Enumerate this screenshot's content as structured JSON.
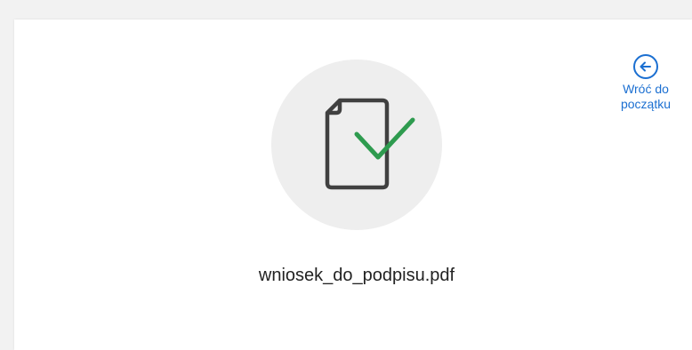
{
  "back": {
    "icon": "arrow-left-circle-icon",
    "label_line1": "Wróć do",
    "label_line2": "początku",
    "color": "#1b6fd1"
  },
  "document": {
    "icon": "document-check-icon",
    "file_name": "wniosek_do_podpisu.pdf",
    "check_color": "#2e9b4f",
    "outline_color": "#404040",
    "circle_color": "#eeeeee"
  }
}
